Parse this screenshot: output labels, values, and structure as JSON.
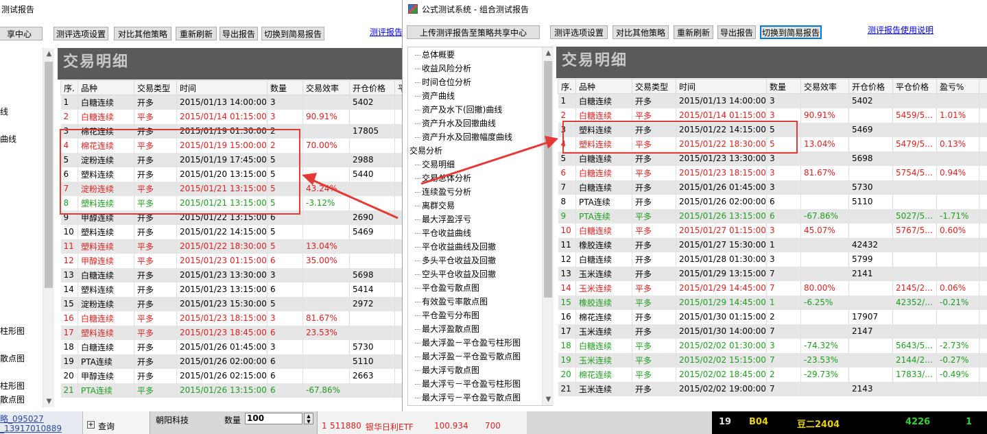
{
  "left_window": {
    "title_fragment": "测试报告",
    "share_fragment": "享中心",
    "buttons": [
      "测评选项设置",
      "对比其他策略",
      "重新刷新",
      "导出报告",
      "切换到简易报告"
    ],
    "help_fragment": "测评报告",
    "panel_title": "交易明细",
    "left_labels": [
      "线",
      "曲线",
      "柱形图",
      "散点图",
      "柱形图",
      "散点图"
    ],
    "columns": [
      "序.",
      "品种",
      "交易类型",
      "时间",
      "数量",
      "交易效率",
      "开仓价格",
      "平"
    ],
    "rows": [
      {
        "n": "1",
        "sym": "白糖连续",
        "type": "开多",
        "time": "2015/01/13 14:00:00",
        "qty": "3",
        "eff": "",
        "open": "5402",
        "color": "black"
      },
      {
        "n": "2",
        "sym": "白糖连续",
        "type": "平多",
        "time": "2015/01/14 01:15:00",
        "qty": "3",
        "eff": "90.91%",
        "open": "",
        "color": "red"
      },
      {
        "n": "3",
        "sym": "棉花连续",
        "type": "开多",
        "time": "2015/01/19 01:30:00",
        "qty": "2",
        "eff": "",
        "open": "17805",
        "color": "black"
      },
      {
        "n": "4",
        "sym": "棉花连续",
        "type": "平多",
        "time": "2015/01/19 15:00:00",
        "qty": "2",
        "eff": "70.00%",
        "open": "",
        "color": "red"
      },
      {
        "n": "5",
        "sym": "淀粉连续",
        "type": "开多",
        "time": "2015/01/19 17:45:00",
        "qty": "5",
        "eff": "",
        "open": "2988",
        "color": "black"
      },
      {
        "n": "6",
        "sym": "塑料连续",
        "type": "开多",
        "time": "2015/01/20 13:15:00",
        "qty": "5",
        "eff": "",
        "open": "5440",
        "color": "black"
      },
      {
        "n": "7",
        "sym": "淀粉连续",
        "type": "平多",
        "time": "2015/01/21 13:15:00",
        "qty": "5",
        "eff": "43.24%",
        "open": "",
        "color": "red"
      },
      {
        "n": "8",
        "sym": "塑料连续",
        "type": "平多",
        "time": "2015/01/21 13:15:00",
        "qty": "5",
        "eff": "-3.12%",
        "open": "",
        "color": "green"
      },
      {
        "n": "9",
        "sym": "甲醇连续",
        "type": "开多",
        "time": "2015/01/22 13:15:00",
        "qty": "6",
        "eff": "",
        "open": "2690",
        "color": "black"
      },
      {
        "n": "10",
        "sym": "塑料连续",
        "type": "开多",
        "time": "2015/01/22 14:15:00",
        "qty": "5",
        "eff": "",
        "open": "5469",
        "color": "black"
      },
      {
        "n": "11",
        "sym": "塑料连续",
        "type": "平多",
        "time": "2015/01/22 18:30:00",
        "qty": "5",
        "eff": "13.04%",
        "open": "",
        "color": "red"
      },
      {
        "n": "12",
        "sym": "甲醇连续",
        "type": "平多",
        "time": "2015/01/23 01:15:00",
        "qty": "6",
        "eff": "35.00%",
        "open": "",
        "color": "red"
      },
      {
        "n": "13",
        "sym": "白糖连续",
        "type": "开多",
        "time": "2015/01/23 13:30:00",
        "qty": "3",
        "eff": "",
        "open": "5698",
        "color": "black"
      },
      {
        "n": "14",
        "sym": "塑料连续",
        "type": "开多",
        "time": "2015/01/23 13:15:00",
        "qty": "6",
        "eff": "",
        "open": "5414",
        "color": "black"
      },
      {
        "n": "15",
        "sym": "淀粉连续",
        "type": "开多",
        "time": "2015/01/23 15:30:00",
        "qty": "5",
        "eff": "",
        "open": "2972",
        "color": "black"
      },
      {
        "n": "16",
        "sym": "白糖连续",
        "type": "平多",
        "time": "2015/01/23 18:15:00",
        "qty": "3",
        "eff": "81.67%",
        "open": "",
        "color": "red"
      },
      {
        "n": "17",
        "sym": "塑料连续",
        "type": "平多",
        "time": "2015/01/23 18:45:00",
        "qty": "6",
        "eff": "23.53%",
        "open": "",
        "color": "red"
      },
      {
        "n": "18",
        "sym": "白糖连续",
        "type": "开多",
        "time": "2015/01/26 01:45:00",
        "qty": "3",
        "eff": "",
        "open": "5730",
        "color": "black"
      },
      {
        "n": "19",
        "sym": "PTA连续",
        "type": "开多",
        "time": "2015/01/26 02:00:00",
        "qty": "6",
        "eff": "",
        "open": "5110",
        "color": "black"
      },
      {
        "n": "20",
        "sym": "甲醇连续",
        "type": "开多",
        "time": "2015/01/26 02:15:00",
        "qty": "6",
        "eff": "",
        "open": "2663",
        "color": "black"
      },
      {
        "n": "21",
        "sym": "PTA连续",
        "type": "平多",
        "time": "2015/01/26 13:15:00",
        "qty": "6",
        "eff": "-67.86%",
        "open": "",
        "color": "green"
      }
    ]
  },
  "right_window": {
    "title": "公式测试系统 - 组合测试报告",
    "upload_button": "上传测评报告至策略共享中心",
    "buttons": [
      "测评选项设置",
      "对比其他策略",
      "重新刷新",
      "导出报告",
      "切换到简易报告"
    ],
    "help_link": "测评报告使用说明",
    "panel_title": "交易明细",
    "tree": [
      {
        "label": "总体概要",
        "indent": 1
      },
      {
        "label": "收益风险分析",
        "indent": 1
      },
      {
        "label": "时间仓位分析",
        "indent": 1
      },
      {
        "label": "资产曲线",
        "indent": 1
      },
      {
        "label": "资产及水下(回撤)曲线",
        "indent": 1
      },
      {
        "label": "资产升水及回撤曲线",
        "indent": 1
      },
      {
        "label": "资产升水及回撤幅度曲线",
        "indent": 1
      },
      {
        "label": "交易分析",
        "indent": 0
      },
      {
        "label": "交易明细",
        "indent": 1
      },
      {
        "label": "交易总体分析",
        "indent": 1
      },
      {
        "label": "连续盈亏分析",
        "indent": 1
      },
      {
        "label": "离群交易",
        "indent": 1
      },
      {
        "label": "最大浮盈浮亏",
        "indent": 1
      },
      {
        "label": "平仓收益曲线",
        "indent": 1
      },
      {
        "label": "平仓收益曲线及回撤",
        "indent": 1
      },
      {
        "label": "多头平仓收益及回撤",
        "indent": 1
      },
      {
        "label": "空头平仓收益及回撤",
        "indent": 1
      },
      {
        "label": "平仓盈亏散点图",
        "indent": 1
      },
      {
        "label": "有效盈亏率散点图",
        "indent": 1
      },
      {
        "label": "平仓盈亏分布图",
        "indent": 1
      },
      {
        "label": "最大浮盈散点图",
        "indent": 1
      },
      {
        "label": "最大浮盈－平仓盈亏柱形图",
        "indent": 1
      },
      {
        "label": "最大浮盈－平仓盈亏散点图",
        "indent": 1
      },
      {
        "label": "最大浮亏散点图",
        "indent": 1
      },
      {
        "label": "最大浮亏－平仓盈亏柱形图",
        "indent": 1
      },
      {
        "label": "最大浮亏－平仓盈亏散点图",
        "indent": 1
      }
    ],
    "columns": [
      "序.",
      "品种",
      "交易类型",
      "时间",
      "数量",
      "交易效率",
      "开仓价格",
      "平仓价格",
      "盈亏%",
      ""
    ],
    "rows": [
      {
        "n": "1",
        "sym": "白糖连续",
        "type": "开多",
        "time": "2015/01/13 14:00:00",
        "qty": "3",
        "eff": "",
        "open": "5402",
        "close": "",
        "pl": "",
        "color": "black"
      },
      {
        "n": "2",
        "sym": "白糖连续",
        "type": "平多",
        "time": "2015/01/14 01:15:00",
        "qty": "3",
        "eff": "90.91%",
        "open": "",
        "close": "5459/5...",
        "pl": "1.01%",
        "color": "red"
      },
      {
        "n": "3",
        "sym": "塑料连续",
        "type": "开多",
        "time": "2015/01/22 14:15:00",
        "qty": "5",
        "eff": "",
        "open": "5469",
        "close": "",
        "pl": "",
        "color": "black"
      },
      {
        "n": "4",
        "sym": "塑料连续",
        "type": "平多",
        "time": "2015/01/22 18:30:00",
        "qty": "5",
        "eff": "13.04%",
        "open": "",
        "close": "5479/5...",
        "pl": "0.13%",
        "color": "red"
      },
      {
        "n": "5",
        "sym": "白糖连续",
        "type": "开多",
        "time": "2015/01/23 13:30:00",
        "qty": "3",
        "eff": "",
        "open": "5698",
        "close": "",
        "pl": "",
        "color": "black"
      },
      {
        "n": "6",
        "sym": "白糖连续",
        "type": "平多",
        "time": "2015/01/23 18:15:00",
        "qty": "3",
        "eff": "81.67%",
        "open": "",
        "close": "5754/5...",
        "pl": "0.94%",
        "color": "red"
      },
      {
        "n": "7",
        "sym": "白糖连续",
        "type": "开多",
        "time": "2015/01/26 01:45:00",
        "qty": "3",
        "eff": "",
        "open": "5730",
        "close": "",
        "pl": "",
        "color": "black"
      },
      {
        "n": "8",
        "sym": "PTA连续",
        "type": "开多",
        "time": "2015/01/26 02:00:00",
        "qty": "6",
        "eff": "",
        "open": "5110",
        "close": "",
        "pl": "",
        "color": "black"
      },
      {
        "n": "9",
        "sym": "PTA连续",
        "type": "平多",
        "time": "2015/01/26 13:15:00",
        "qty": "6",
        "eff": "-67.86%",
        "open": "",
        "close": "5027/5...",
        "pl": "-1.71%",
        "color": "green"
      },
      {
        "n": "10",
        "sym": "白糖连续",
        "type": "平多",
        "time": "2015/01/27 01:15:00",
        "qty": "3",
        "eff": "45.07%",
        "open": "",
        "close": "5767/5...",
        "pl": "0.60%",
        "color": "red"
      },
      {
        "n": "11",
        "sym": "橡胶连续",
        "type": "开多",
        "time": "2015/01/27 15:30:00",
        "qty": "1",
        "eff": "",
        "open": "42432",
        "close": "",
        "pl": "",
        "color": "black"
      },
      {
        "n": "12",
        "sym": "白糖连续",
        "type": "开多",
        "time": "2015/01/28 01:30:00",
        "qty": "3",
        "eff": "",
        "open": "5799",
        "close": "",
        "pl": "",
        "color": "black"
      },
      {
        "n": "13",
        "sym": "玉米连续",
        "type": "开多",
        "time": "2015/01/29 13:15:00",
        "qty": "7",
        "eff": "",
        "open": "2141",
        "close": "",
        "pl": "",
        "color": "black"
      },
      {
        "n": "14",
        "sym": "玉米连续",
        "type": "平多",
        "time": "2015/01/29 14:45:00",
        "qty": "7",
        "eff": "80.00%",
        "open": "",
        "close": "2145/2...",
        "pl": "0.06%",
        "color": "red"
      },
      {
        "n": "15",
        "sym": "橡胶连续",
        "type": "平多",
        "time": "2015/01/29 14:45:00",
        "qty": "1",
        "eff": "-6.25%",
        "open": "",
        "close": "42352/...",
        "pl": "-0.21%",
        "color": "green"
      },
      {
        "n": "16",
        "sym": "棉花连续",
        "type": "开多",
        "time": "2015/01/30 01:15:00",
        "qty": "2",
        "eff": "",
        "open": "17907",
        "close": "",
        "pl": "",
        "color": "black"
      },
      {
        "n": "17",
        "sym": "玉米连续",
        "type": "开多",
        "time": "2015/01/30 14:00:00",
        "qty": "7",
        "eff": "",
        "open": "2147",
        "close": "",
        "pl": "",
        "color": "black"
      },
      {
        "n": "18",
        "sym": "白糖连续",
        "type": "平多",
        "time": "2015/02/02 01:30:00",
        "qty": "3",
        "eff": "-74.32%",
        "open": "",
        "close": "5643/5...",
        "pl": "-2.73%",
        "color": "green"
      },
      {
        "n": "19",
        "sym": "玉米连续",
        "type": "平多",
        "time": "2015/02/02 15:15:00",
        "qty": "7",
        "eff": "-23.53%",
        "open": "",
        "close": "2144/2...",
        "pl": "-0.27%",
        "color": "green"
      },
      {
        "n": "20",
        "sym": "棉花连续",
        "type": "平多",
        "time": "2015/02/02 18:45:00",
        "qty": "2",
        "eff": "-29.73%",
        "open": "",
        "close": "17833/...",
        "pl": "-0.49%",
        "color": "green"
      },
      {
        "n": "21",
        "sym": "玉米连续",
        "type": "开多",
        "time": "2015/02/02 19:00:00",
        "qty": "7",
        "eff": "",
        "open": "2143",
        "close": "",
        "pl": "",
        "color": "black"
      }
    ]
  },
  "taskbar": {
    "left_fragment_1": "略_095027",
    "left_fragment_2": "_13917010889",
    "query_label": "查询",
    "company": "朝阳科技",
    "qty_label": "数量",
    "qty_value": "100",
    "etf_row": {
      "n": "1",
      "code": "511880",
      "name": "银华日利ETF",
      "price": "100.934",
      "vol": "700"
    },
    "quote": {
      "n": "19",
      "code": "B04",
      "name": "豆二2404",
      "price": "4226",
      "qty": "1"
    }
  },
  "colors": {
    "accent_red": "#e53935",
    "up": "#e02020",
    "down": "#1e9e1e",
    "panel": "#5a5a5a"
  }
}
